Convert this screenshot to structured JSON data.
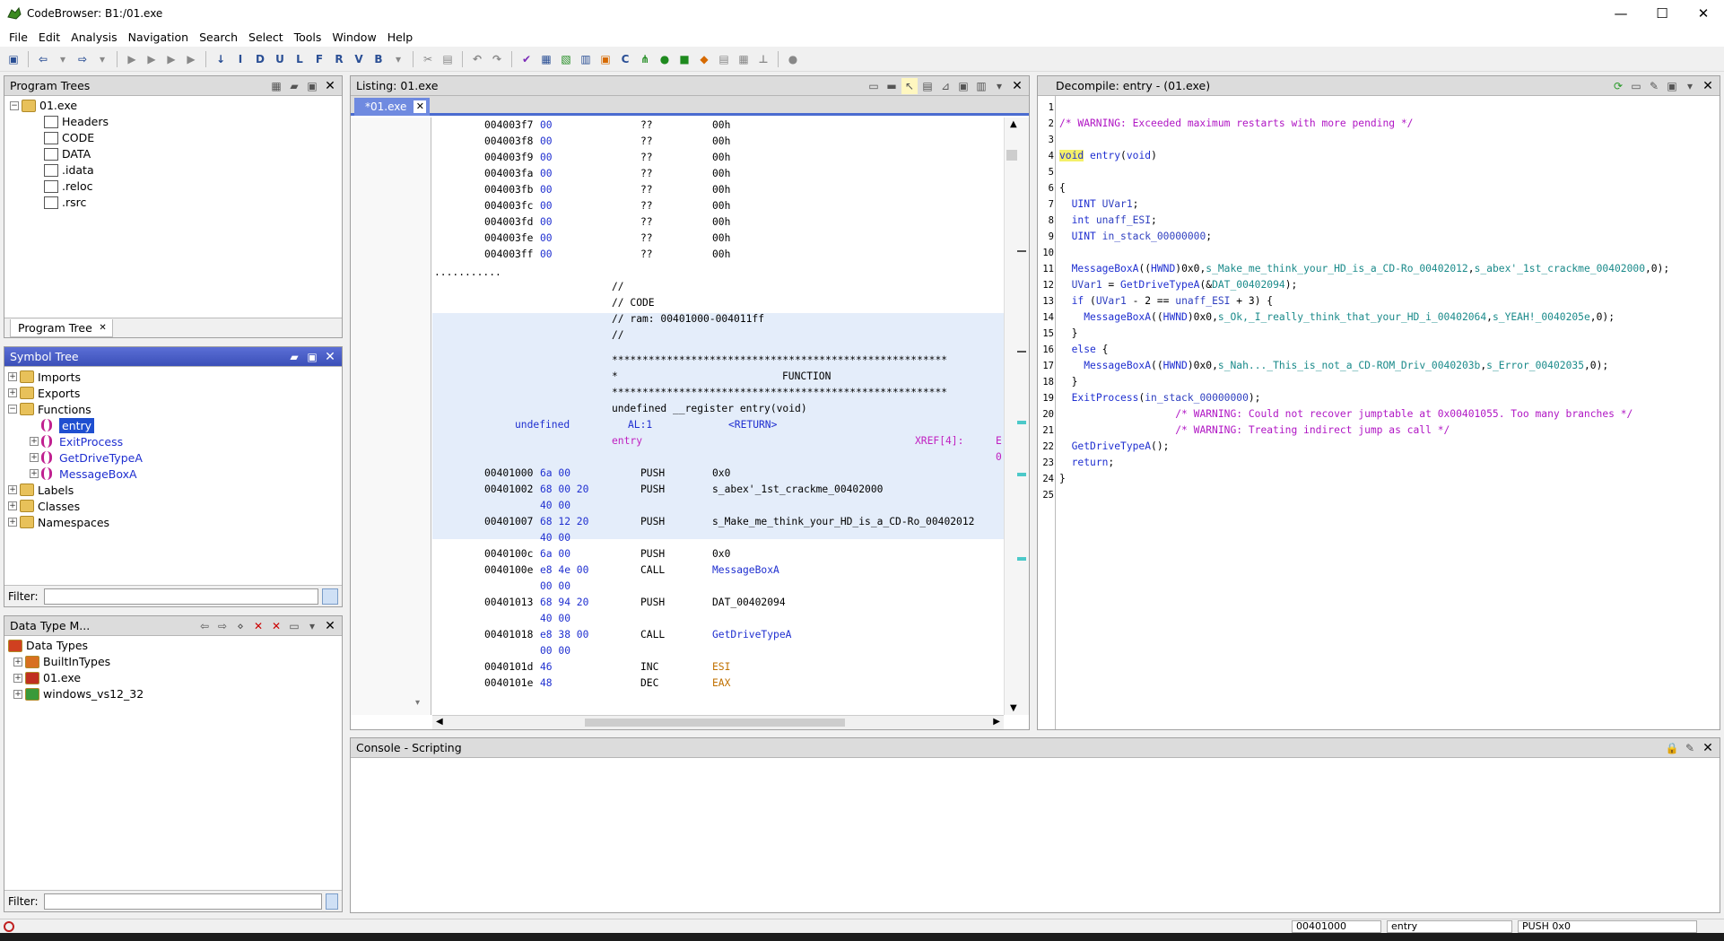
{
  "window": {
    "title": "CodeBrowser: B1:/01.exe",
    "min": "—",
    "max": "☐",
    "close": "✕"
  },
  "menu": [
    "File",
    "Edit",
    "Analysis",
    "Navigation",
    "Search",
    "Select",
    "Tools",
    "Window",
    "Help"
  ],
  "program_trees": {
    "title": "Program Trees",
    "root": "01.exe",
    "items": [
      "Headers",
      "CODE",
      "DATA",
      ".idata",
      ".reloc",
      ".rsrc"
    ],
    "tab": "Program Tree"
  },
  "symbol_tree": {
    "title": "Symbol Tree",
    "items": [
      {
        "label": "Imports",
        "depth": 0,
        "kind": "folder"
      },
      {
        "label": "Exports",
        "depth": 0,
        "kind": "folder"
      },
      {
        "label": "Functions",
        "depth": 0,
        "kind": "folder"
      },
      {
        "label": "entry",
        "depth": 1,
        "kind": "function",
        "selected": true
      },
      {
        "label": "ExitProcess",
        "depth": 1,
        "kind": "function"
      },
      {
        "label": "GetDriveTypeA",
        "depth": 1,
        "kind": "function"
      },
      {
        "label": "MessageBoxA",
        "depth": 1,
        "kind": "function"
      },
      {
        "label": "Labels",
        "depth": 0,
        "kind": "folder"
      },
      {
        "label": "Classes",
        "depth": 0,
        "kind": "folder"
      },
      {
        "label": "Namespaces",
        "depth": 0,
        "kind": "folder"
      }
    ],
    "filter_label": "Filter:"
  },
  "data_type_manager": {
    "title": "Data Type M...",
    "root": "Data Types",
    "items": [
      "BuiltInTypes",
      "01.exe",
      "windows_vs12_32"
    ],
    "filter_label": "Filter:"
  },
  "listing": {
    "title": "Listing:  01.exe",
    "tab": "*01.exe",
    "rows_top": [
      [
        "004003f7",
        "00",
        "??",
        "00h"
      ],
      [
        "004003f8",
        "00",
        "??",
        "00h"
      ],
      [
        "004003f9",
        "00",
        "??",
        "00h"
      ],
      [
        "004003fa",
        "00",
        "??",
        "00h"
      ],
      [
        "004003fb",
        "00",
        "??",
        "00h"
      ],
      [
        "004003fc",
        "00",
        "??",
        "00h"
      ],
      [
        "004003fd",
        "00",
        "??",
        "00h"
      ],
      [
        "004003fe",
        "00",
        "??",
        "00h"
      ],
      [
        "004003ff",
        "00",
        "??",
        "00h"
      ]
    ],
    "dots": "...........",
    "block_comments": [
      "//",
      "// CODE",
      "// ram: 00401000-004011ff",
      "//"
    ],
    "stars": "*******************************************************",
    "function_banner": "FUNCTION",
    "signature": "undefined __register entry(void)",
    "ret_type": "undefined",
    "ret_storage": "AL:1",
    "ret_name": "<RETURN>",
    "label": "entry",
    "xref": "XREF[4]:",
    "xref_trunc": "E",
    "xref_trunc2": "0",
    "instructions": [
      {
        "addr": "00401000",
        "bytes": "6a 00",
        "mn": "PUSH",
        "op": "0x0",
        "kind": "num"
      },
      {
        "addr": "00401002",
        "bytes": "68 00 20",
        "bytes2": "40 00",
        "mn": "PUSH",
        "op": "s_abex'_1st_crackme_00402000",
        "kind": "sym"
      },
      {
        "addr": "00401007",
        "bytes": "68 12 20",
        "bytes2": "40 00",
        "mn": "PUSH",
        "op": "s_Make_me_think_your_HD_is_a_CD-Ro_00402012",
        "kind": "sym"
      },
      {
        "addr": "0040100c",
        "bytes": "6a 00",
        "mn": "PUSH",
        "op": "0x0",
        "kind": "num"
      },
      {
        "addr": "0040100e",
        "bytes": "e8 4e 00",
        "bytes2": "00 00",
        "mn": "CALL",
        "op": "MessageBoxA",
        "kind": "fn"
      },
      {
        "addr": "00401013",
        "bytes": "68 94 20",
        "bytes2": "40 00",
        "mn": "PUSH",
        "op": "DAT_00402094",
        "kind": "sym"
      },
      {
        "addr": "00401018",
        "bytes": "e8 38 00",
        "bytes2": "00 00",
        "mn": "CALL",
        "op": "GetDriveTypeA",
        "kind": "fn"
      },
      {
        "addr": "0040101d",
        "bytes": "46",
        "mn": "INC",
        "op": "ESI",
        "kind": "reg"
      },
      {
        "addr": "0040101e",
        "bytes": "48",
        "mn": "DEC",
        "op": "EAX",
        "kind": "reg"
      }
    ]
  },
  "decompile": {
    "title": "Decompile: entry -  (01.exe)",
    "lines": [
      {
        "n": "1",
        "html": ""
      },
      {
        "n": "2",
        "t": [
          [
            "d-cmt",
            "/* WARNING: Exceeded maximum restarts with more pending */"
          ]
        ]
      },
      {
        "n": "3",
        "t": []
      },
      {
        "n": "4",
        "t": [
          [
            "d-kwhl",
            "void"
          ],
          [
            "",
            " "
          ],
          [
            "d-fn",
            "entry"
          ],
          [
            "",
            "("
          ],
          [
            "d-kw",
            "void"
          ],
          [
            "",
            ")"
          ]
        ]
      },
      {
        "n": "5",
        "t": []
      },
      {
        "n": "6",
        "t": [
          [
            "",
            "{"
          ]
        ]
      },
      {
        "n": "7",
        "t": [
          [
            "",
            "  "
          ],
          [
            "d-kw",
            "UINT"
          ],
          [
            "",
            " "
          ],
          [
            "d-var",
            "UVar1"
          ],
          [
            "",
            ";"
          ]
        ]
      },
      {
        "n": "8",
        "t": [
          [
            "",
            "  "
          ],
          [
            "d-kw",
            "int"
          ],
          [
            "",
            " "
          ],
          [
            "d-var",
            "unaff_ESI"
          ],
          [
            "",
            ";"
          ]
        ]
      },
      {
        "n": "9",
        "t": [
          [
            "",
            "  "
          ],
          [
            "d-kw",
            "UINT"
          ],
          [
            "",
            " "
          ],
          [
            "d-var",
            "in_stack_00000000"
          ],
          [
            "",
            ";"
          ]
        ]
      },
      {
        "n": "10",
        "t": []
      },
      {
        "n": "11",
        "t": [
          [
            "",
            "  "
          ],
          [
            "d-fn",
            "MessageBoxA"
          ],
          [
            "",
            "(("
          ],
          [
            "d-kw",
            "HWND"
          ],
          [
            "",
            ")0x0,"
          ],
          [
            "d-str",
            "s_Make_me_think_your_HD_is_a_CD-Ro_00402012"
          ],
          [
            "",
            ","
          ],
          [
            "d-str",
            "s_abex'_1st_crackme_00402000"
          ],
          [
            "",
            ",0);"
          ]
        ]
      },
      {
        "n": "12",
        "t": [
          [
            "",
            "  "
          ],
          [
            "d-var",
            "UVar1"
          ],
          [
            "",
            " = "
          ],
          [
            "d-fn",
            "GetDriveTypeA"
          ],
          [
            "",
            "(&"
          ],
          [
            "d-str",
            "DAT_00402094"
          ],
          [
            "",
            ");"
          ]
        ]
      },
      {
        "n": "13",
        "t": [
          [
            "",
            "  "
          ],
          [
            "d-kw",
            "if"
          ],
          [
            "",
            " ("
          ],
          [
            "d-var",
            "UVar1"
          ],
          [
            "",
            " - 2 == "
          ],
          [
            "d-var",
            "unaff_ESI"
          ],
          [
            "",
            " + 3) {"
          ]
        ]
      },
      {
        "n": "14",
        "t": [
          [
            "",
            "    "
          ],
          [
            "d-fn",
            "MessageBoxA"
          ],
          [
            "",
            "(("
          ],
          [
            "d-kw",
            "HWND"
          ],
          [
            "",
            ")0x0,"
          ],
          [
            "d-str",
            "s_Ok,_I_really_think_that_your_HD_i_00402064"
          ],
          [
            "",
            ","
          ],
          [
            "d-str",
            "s_YEAH!_0040205e"
          ],
          [
            "",
            ",0);"
          ]
        ]
      },
      {
        "n": "15",
        "t": [
          [
            "",
            "  }"
          ]
        ]
      },
      {
        "n": "16",
        "t": [
          [
            "",
            "  "
          ],
          [
            "d-kw",
            "else"
          ],
          [
            "",
            " {"
          ]
        ]
      },
      {
        "n": "17",
        "t": [
          [
            "",
            "    "
          ],
          [
            "d-fn",
            "MessageBoxA"
          ],
          [
            "",
            "(("
          ],
          [
            "d-kw",
            "HWND"
          ],
          [
            "",
            ")0x0,"
          ],
          [
            "d-str",
            "s_Nah..._This_is_not_a_CD-ROM_Driv_0040203b"
          ],
          [
            "",
            ","
          ],
          [
            "d-str",
            "s_Error_00402035"
          ],
          [
            "",
            ",0);"
          ]
        ]
      },
      {
        "n": "18",
        "t": [
          [
            "",
            "  }"
          ]
        ]
      },
      {
        "n": "19",
        "t": [
          [
            "",
            "  "
          ],
          [
            "d-fn",
            "ExitProcess"
          ],
          [
            "",
            "("
          ],
          [
            "d-var",
            "in_stack_00000000"
          ],
          [
            "",
            ");"
          ]
        ]
      },
      {
        "n": "20",
        "t": [
          [
            "",
            "                   "
          ],
          [
            "d-cmt",
            "/* WARNING: Could not recover jumptable at 0x00401055. Too many branches */"
          ]
        ]
      },
      {
        "n": "21",
        "t": [
          [
            "",
            "                   "
          ],
          [
            "d-cmt",
            "/* WARNING: Treating indirect jump as call */"
          ]
        ]
      },
      {
        "n": "22",
        "t": [
          [
            "",
            "  "
          ],
          [
            "d-fn",
            "GetDriveTypeA"
          ],
          [
            "",
            "();"
          ]
        ]
      },
      {
        "n": "23",
        "t": [
          [
            "",
            "  "
          ],
          [
            "d-kw",
            "return"
          ],
          [
            "",
            ";"
          ]
        ]
      },
      {
        "n": "24",
        "t": [
          [
            "",
            "}"
          ]
        ]
      },
      {
        "n": "25",
        "t": []
      }
    ]
  },
  "console": {
    "title": "Console - Scripting"
  },
  "status": {
    "address": "00401000",
    "function": "entry",
    "instruction": "PUSH 0x0"
  }
}
